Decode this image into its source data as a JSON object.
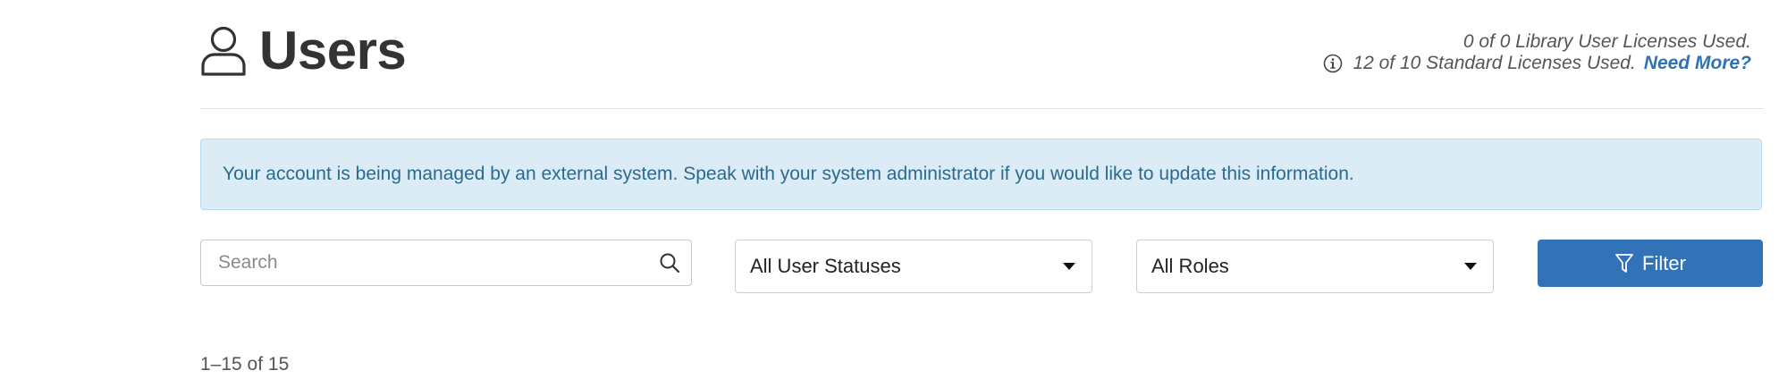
{
  "header": {
    "title": "Users",
    "title_icon": "user-icon",
    "licenses": {
      "library_text": "0 of 0 Library User Licenses Used.",
      "standard_text": "12 of 10 Standard Licenses Used.",
      "need_more_label": "Need More?",
      "info_icon": "info-icon"
    }
  },
  "alert": {
    "message": "Your account is being managed by an external system. Speak with your system administrator if you would like to update this information."
  },
  "filters": {
    "search": {
      "value": "",
      "placeholder": "Search",
      "icon": "search-icon"
    },
    "status_select": {
      "selected": "All User Statuses",
      "icon": "caret-down-icon"
    },
    "roles_select": {
      "selected": "All Roles",
      "icon": "caret-down-icon"
    },
    "filter_button": {
      "label": "Filter",
      "icon": "filter-icon"
    }
  },
  "pagination": {
    "summary": "1–15 of 15"
  },
  "colors": {
    "primary": "#3173b6",
    "link": "#2f72b6",
    "alert_bg": "#dbecf7",
    "alert_text": "#2b6a8c",
    "title_text": "#333333"
  }
}
